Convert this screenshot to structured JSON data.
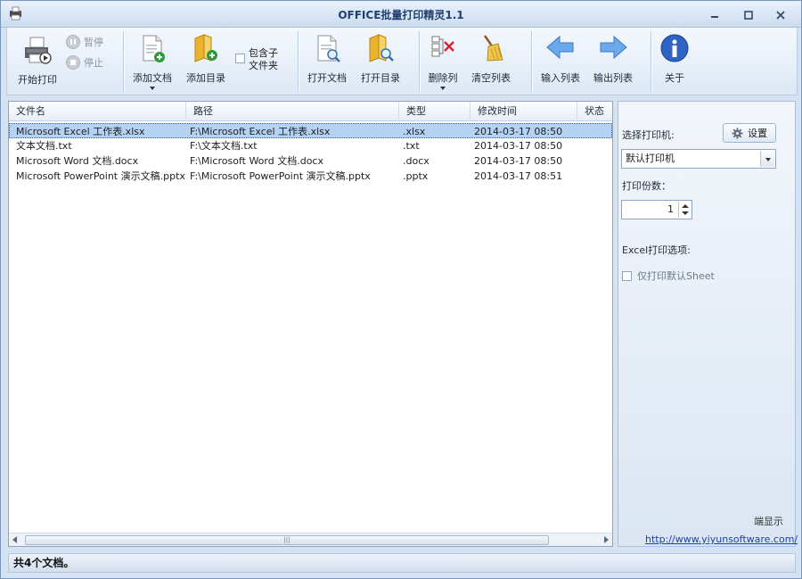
{
  "window": {
    "title": "OFFICE批量打印精灵1.1"
  },
  "toolbar": {
    "start_print": "开始打印",
    "pause": "暂停",
    "stop": "停止",
    "add_doc": "添加文档",
    "add_dir": "添加目录",
    "include_subfolder_line1": "包含子",
    "include_subfolder_line2": "文件夹",
    "open_doc": "打开文档",
    "open_dir": "打开目录",
    "delete_col": "删除列",
    "clear_list": "清空列表",
    "import_list": "输入列表",
    "export_list": "输出列表",
    "about": "关于"
  },
  "list": {
    "columns": [
      "文件名",
      "路径",
      "类型",
      "修改时间",
      "状态"
    ],
    "rows": [
      {
        "name": "Microsoft Excel 工作表.xlsx",
        "path": "F:\\Microsoft Excel 工作表.xlsx",
        "type": ".xlsx",
        "modified": "2014-03-17 08:50",
        "status": ""
      },
      {
        "name": "文本文档.txt",
        "path": "F:\\文本文档.txt",
        "type": ".txt",
        "modified": "2014-03-17 08:50",
        "status": ""
      },
      {
        "name": "Microsoft Word 文档.docx",
        "path": "F:\\Microsoft Word 文档.docx",
        "type": ".docx",
        "modified": "2014-03-17 08:50",
        "status": ""
      },
      {
        "name": "Microsoft PowerPoint 演示文稿.pptx",
        "path": "F:\\Microsoft PowerPoint 演示文稿.pptx",
        "type": ".pptx",
        "modified": "2014-03-17 08:51",
        "status": ""
      }
    ],
    "selected_row": 0
  },
  "panel": {
    "printer_label": "选择打印机:",
    "settings_button": "设置",
    "printer_value": "默认打印机",
    "copies_label": "打印份数：",
    "copies_value": "1",
    "excel_options_label": "Excel打印选项:",
    "only_default_sheet": "仅打印默认Sheet",
    "ad_text": "端显示",
    "website": "http://www.yiyunsoftware.com/"
  },
  "status": {
    "text": "共4个文档。"
  },
  "colors": {
    "accent": "#1f3f6e",
    "selection": "#b6d2f3",
    "link": "#1a3fb0"
  }
}
